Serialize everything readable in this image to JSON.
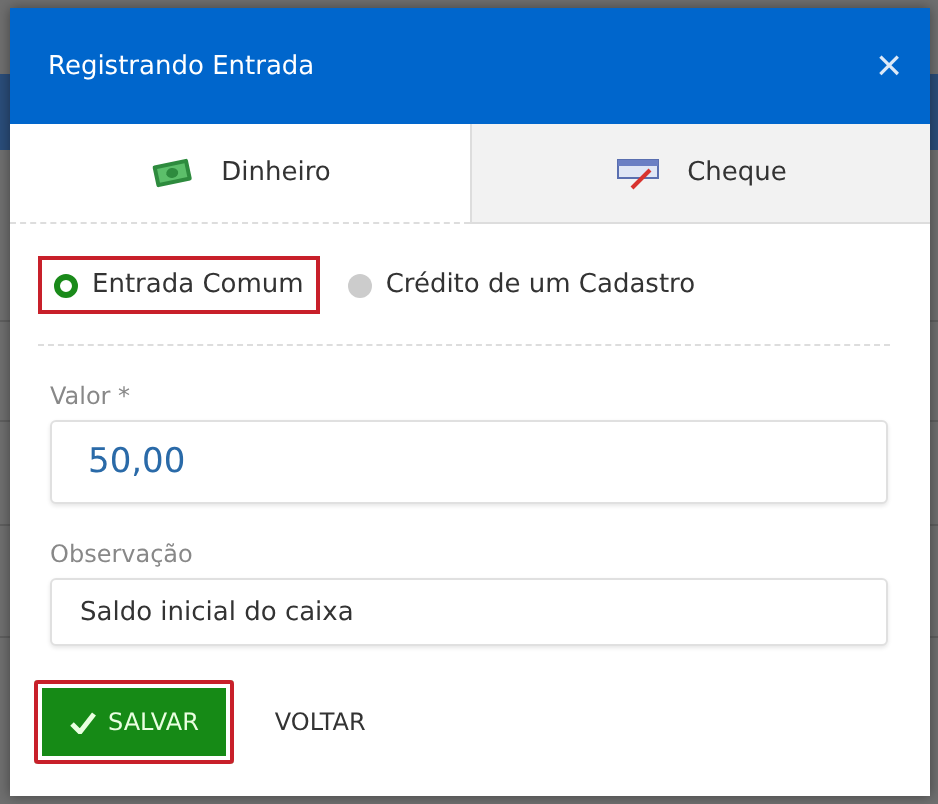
{
  "dialog": {
    "title": "Registrando Entrada",
    "close": "×"
  },
  "tabs": [
    {
      "label": "Dinheiro",
      "kind": "cash",
      "selected": true
    },
    {
      "label": "Cheque",
      "kind": "check",
      "selected": false
    }
  ],
  "entry_type": [
    {
      "label": "Entrada Comum",
      "selected": true,
      "highlighted": true
    },
    {
      "label": "Crédito de um Cadastro",
      "selected": false,
      "highlighted": false
    }
  ],
  "fields": [
    {
      "label": "Valor *",
      "value": "50,00",
      "kind": "amount"
    },
    {
      "label": "Observação",
      "value": "Saldo inicial do caixa",
      "kind": "text"
    }
  ],
  "buttons": [
    {
      "label": "SALVAR",
      "kind": "primary",
      "highlighted": true
    },
    {
      "label": "VOLTAR",
      "kind": "flat",
      "highlighted": false
    }
  ]
}
